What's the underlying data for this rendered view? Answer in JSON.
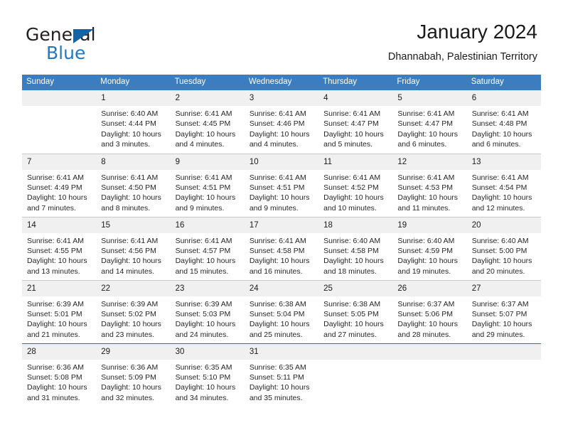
{
  "brand": {
    "name_part1": "General",
    "name_part2": "Blue",
    "triangle_color": "#1464a5",
    "blue_color": "#1f78c1"
  },
  "header": {
    "title": "January 2024",
    "subtitle": "Dhannabah, Palestinian Territory"
  },
  "theme": {
    "header_bg": "#3b7dbf",
    "daynum_bg": "#f0f0f0",
    "grid_line": "#c8c8c8",
    "accent_line": "#2c6fb0"
  },
  "weekday_headers": [
    "Sunday",
    "Monday",
    "Tuesday",
    "Wednesday",
    "Thursday",
    "Friday",
    "Saturday"
  ],
  "weeks": [
    {
      "days": [
        {
          "num": "",
          "sunrise": "",
          "sunset": "",
          "daylight_line1": "",
          "daylight_line2": ""
        },
        {
          "num": "1",
          "sunrise": "Sunrise: 6:40 AM",
          "sunset": "Sunset: 4:44 PM",
          "daylight_line1": "Daylight: 10 hours",
          "daylight_line2": "and 3 minutes."
        },
        {
          "num": "2",
          "sunrise": "Sunrise: 6:41 AM",
          "sunset": "Sunset: 4:45 PM",
          "daylight_line1": "Daylight: 10 hours",
          "daylight_line2": "and 4 minutes."
        },
        {
          "num": "3",
          "sunrise": "Sunrise: 6:41 AM",
          "sunset": "Sunset: 4:46 PM",
          "daylight_line1": "Daylight: 10 hours",
          "daylight_line2": "and 4 minutes."
        },
        {
          "num": "4",
          "sunrise": "Sunrise: 6:41 AM",
          "sunset": "Sunset: 4:47 PM",
          "daylight_line1": "Daylight: 10 hours",
          "daylight_line2": "and 5 minutes."
        },
        {
          "num": "5",
          "sunrise": "Sunrise: 6:41 AM",
          "sunset": "Sunset: 4:47 PM",
          "daylight_line1": "Daylight: 10 hours",
          "daylight_line2": "and 6 minutes."
        },
        {
          "num": "6",
          "sunrise": "Sunrise: 6:41 AM",
          "sunset": "Sunset: 4:48 PM",
          "daylight_line1": "Daylight: 10 hours",
          "daylight_line2": "and 6 minutes."
        }
      ]
    },
    {
      "days": [
        {
          "num": "7",
          "sunrise": "Sunrise: 6:41 AM",
          "sunset": "Sunset: 4:49 PM",
          "daylight_line1": "Daylight: 10 hours",
          "daylight_line2": "and 7 minutes."
        },
        {
          "num": "8",
          "sunrise": "Sunrise: 6:41 AM",
          "sunset": "Sunset: 4:50 PM",
          "daylight_line1": "Daylight: 10 hours",
          "daylight_line2": "and 8 minutes."
        },
        {
          "num": "9",
          "sunrise": "Sunrise: 6:41 AM",
          "sunset": "Sunset: 4:51 PM",
          "daylight_line1": "Daylight: 10 hours",
          "daylight_line2": "and 9 minutes."
        },
        {
          "num": "10",
          "sunrise": "Sunrise: 6:41 AM",
          "sunset": "Sunset: 4:51 PM",
          "daylight_line1": "Daylight: 10 hours",
          "daylight_line2": "and 9 minutes."
        },
        {
          "num": "11",
          "sunrise": "Sunrise: 6:41 AM",
          "sunset": "Sunset: 4:52 PM",
          "daylight_line1": "Daylight: 10 hours",
          "daylight_line2": "and 10 minutes."
        },
        {
          "num": "12",
          "sunrise": "Sunrise: 6:41 AM",
          "sunset": "Sunset: 4:53 PM",
          "daylight_line1": "Daylight: 10 hours",
          "daylight_line2": "and 11 minutes."
        },
        {
          "num": "13",
          "sunrise": "Sunrise: 6:41 AM",
          "sunset": "Sunset: 4:54 PM",
          "daylight_line1": "Daylight: 10 hours",
          "daylight_line2": "and 12 minutes."
        }
      ]
    },
    {
      "days": [
        {
          "num": "14",
          "sunrise": "Sunrise: 6:41 AM",
          "sunset": "Sunset: 4:55 PM",
          "daylight_line1": "Daylight: 10 hours",
          "daylight_line2": "and 13 minutes."
        },
        {
          "num": "15",
          "sunrise": "Sunrise: 6:41 AM",
          "sunset": "Sunset: 4:56 PM",
          "daylight_line1": "Daylight: 10 hours",
          "daylight_line2": "and 14 minutes."
        },
        {
          "num": "16",
          "sunrise": "Sunrise: 6:41 AM",
          "sunset": "Sunset: 4:57 PM",
          "daylight_line1": "Daylight: 10 hours",
          "daylight_line2": "and 15 minutes."
        },
        {
          "num": "17",
          "sunrise": "Sunrise: 6:41 AM",
          "sunset": "Sunset: 4:58 PM",
          "daylight_line1": "Daylight: 10 hours",
          "daylight_line2": "and 16 minutes."
        },
        {
          "num": "18",
          "sunrise": "Sunrise: 6:40 AM",
          "sunset": "Sunset: 4:58 PM",
          "daylight_line1": "Daylight: 10 hours",
          "daylight_line2": "and 18 minutes."
        },
        {
          "num": "19",
          "sunrise": "Sunrise: 6:40 AM",
          "sunset": "Sunset: 4:59 PM",
          "daylight_line1": "Daylight: 10 hours",
          "daylight_line2": "and 19 minutes."
        },
        {
          "num": "20",
          "sunrise": "Sunrise: 6:40 AM",
          "sunset": "Sunset: 5:00 PM",
          "daylight_line1": "Daylight: 10 hours",
          "daylight_line2": "and 20 minutes."
        }
      ]
    },
    {
      "days": [
        {
          "num": "21",
          "sunrise": "Sunrise: 6:39 AM",
          "sunset": "Sunset: 5:01 PM",
          "daylight_line1": "Daylight: 10 hours",
          "daylight_line2": "and 21 minutes."
        },
        {
          "num": "22",
          "sunrise": "Sunrise: 6:39 AM",
          "sunset": "Sunset: 5:02 PM",
          "daylight_line1": "Daylight: 10 hours",
          "daylight_line2": "and 23 minutes."
        },
        {
          "num": "23",
          "sunrise": "Sunrise: 6:39 AM",
          "sunset": "Sunset: 5:03 PM",
          "daylight_line1": "Daylight: 10 hours",
          "daylight_line2": "and 24 minutes."
        },
        {
          "num": "24",
          "sunrise": "Sunrise: 6:38 AM",
          "sunset": "Sunset: 5:04 PM",
          "daylight_line1": "Daylight: 10 hours",
          "daylight_line2": "and 25 minutes."
        },
        {
          "num": "25",
          "sunrise": "Sunrise: 6:38 AM",
          "sunset": "Sunset: 5:05 PM",
          "daylight_line1": "Daylight: 10 hours",
          "daylight_line2": "and 27 minutes."
        },
        {
          "num": "26",
          "sunrise": "Sunrise: 6:37 AM",
          "sunset": "Sunset: 5:06 PM",
          "daylight_line1": "Daylight: 10 hours",
          "daylight_line2": "and 28 minutes."
        },
        {
          "num": "27",
          "sunrise": "Sunrise: 6:37 AM",
          "sunset": "Sunset: 5:07 PM",
          "daylight_line1": "Daylight: 10 hours",
          "daylight_line2": "and 29 minutes."
        }
      ]
    },
    {
      "days": [
        {
          "num": "28",
          "sunrise": "Sunrise: 6:36 AM",
          "sunset": "Sunset: 5:08 PM",
          "daylight_line1": "Daylight: 10 hours",
          "daylight_line2": "and 31 minutes."
        },
        {
          "num": "29",
          "sunrise": "Sunrise: 6:36 AM",
          "sunset": "Sunset: 5:09 PM",
          "daylight_line1": "Daylight: 10 hours",
          "daylight_line2": "and 32 minutes."
        },
        {
          "num": "30",
          "sunrise": "Sunrise: 6:35 AM",
          "sunset": "Sunset: 5:10 PM",
          "daylight_line1": "Daylight: 10 hours",
          "daylight_line2": "and 34 minutes."
        },
        {
          "num": "31",
          "sunrise": "Sunrise: 6:35 AM",
          "sunset": "Sunset: 5:11 PM",
          "daylight_line1": "Daylight: 10 hours",
          "daylight_line2": "and 35 minutes."
        },
        {
          "num": "",
          "sunrise": "",
          "sunset": "",
          "daylight_line1": "",
          "daylight_line2": ""
        },
        {
          "num": "",
          "sunrise": "",
          "sunset": "",
          "daylight_line1": "",
          "daylight_line2": ""
        },
        {
          "num": "",
          "sunrise": "",
          "sunset": "",
          "daylight_line1": "",
          "daylight_line2": ""
        }
      ]
    }
  ]
}
